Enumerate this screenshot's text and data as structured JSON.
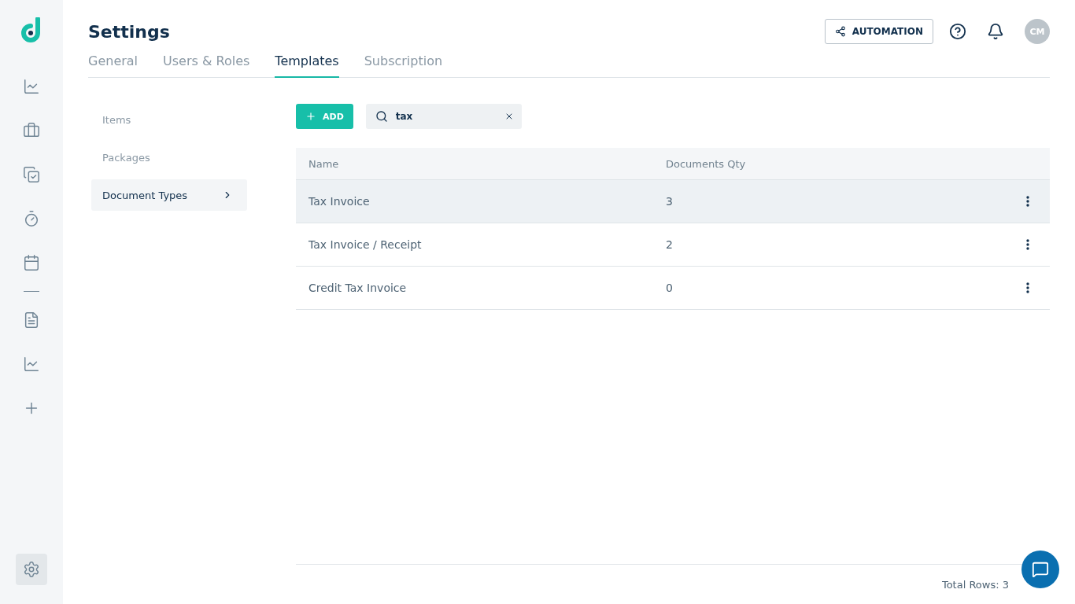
{
  "sidebar": {
    "items": [
      {
        "kind": "chart",
        "selected": false
      },
      {
        "kind": "briefcase",
        "selected": false
      },
      {
        "kind": "tasks",
        "selected": false
      },
      {
        "kind": "timer",
        "selected": false
      },
      {
        "kind": "calendar",
        "selected": false
      },
      {
        "kind": "divider"
      },
      {
        "kind": "document",
        "selected": false
      },
      {
        "kind": "chart",
        "selected": false
      },
      {
        "kind": "plus",
        "selected": false
      }
    ],
    "bottom": [
      {
        "kind": "settings",
        "selected": true
      }
    ]
  },
  "header": {
    "title": "Settings",
    "automation_button": "AUTOMATION",
    "avatar": "CM"
  },
  "tabs": [
    {
      "label": "General",
      "selected": false
    },
    {
      "label": "Users & Roles",
      "selected": false
    },
    {
      "label": "Templates",
      "selected": true
    },
    {
      "label": "Subscription",
      "selected": false
    }
  ],
  "submenu": [
    {
      "label": "Items",
      "selected": false
    },
    {
      "label": "Packages",
      "selected": false
    },
    {
      "label": "Document Types",
      "selected": true
    }
  ],
  "add_button": "ADD",
  "search": {
    "value": "tax"
  },
  "table": {
    "columns": [
      "Name",
      "Documents Qty"
    ],
    "rows": [
      {
        "name": "Tax Invoice",
        "qty": "3",
        "highlighted": true
      },
      {
        "name": "Tax Invoice / Receipt",
        "qty": "2",
        "highlighted": false
      },
      {
        "name": "Credit Tax Invoice",
        "qty": "0",
        "highlighted": false
      }
    ]
  },
  "footer": {
    "total": "Total Rows: 3"
  }
}
